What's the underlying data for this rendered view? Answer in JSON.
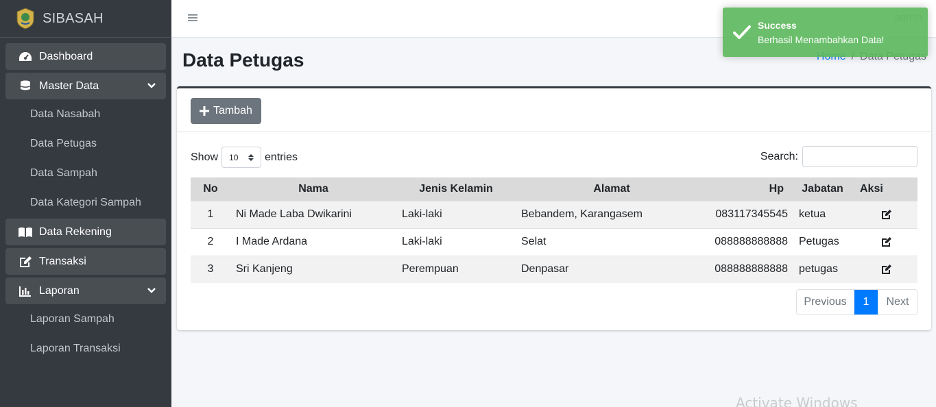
{
  "brand": {
    "name": "SIBASAH"
  },
  "sidebar": {
    "items": [
      {
        "label": "Dashboard",
        "icon": "tachometer-icon"
      },
      {
        "label": "Master Data",
        "icon": "database-icon"
      },
      {
        "label": "Data Rekening",
        "icon": "book-icon"
      },
      {
        "label": "Transaksi",
        "icon": "edit-icon"
      },
      {
        "label": "Laporan",
        "icon": "chart-bar-icon"
      }
    ],
    "master_sub": [
      "Data Nasabah",
      "Data Petugas",
      "Data Sampah",
      "Data Kategori Sampah"
    ],
    "laporan_sub": [
      "Laporan Sampah",
      "Laporan Transaksi"
    ]
  },
  "topbar": {
    "user_label": "admin"
  },
  "page": {
    "title": "Data Petugas"
  },
  "breadcrumb": {
    "home": "Home",
    "separator": "/",
    "current": "Data Petugas"
  },
  "card": {
    "add_button": "Tambah",
    "show_label": "Show",
    "entries_label": "entries",
    "page_length": "10",
    "search_label": "Search:"
  },
  "table": {
    "headers": [
      "No",
      "Nama",
      "Jenis Kelamin",
      "Alamat",
      "Hp",
      "Jabatan",
      "Aksi"
    ],
    "rows": [
      [
        "1",
        "Ni Made Laba Dwikarini",
        "Laki-laki",
        "Bebandem, Karangasem",
        "083117345545",
        "ketua"
      ],
      [
        "2",
        "I Made Ardana",
        "Laki-laki",
        "Selat",
        "088888888888",
        "Petugas"
      ],
      [
        "3",
        "Sri Kanjeng",
        "Perempuan",
        "Denpasar",
        "088888888888",
        "petugas"
      ]
    ]
  },
  "pagination": {
    "previous": "Previous",
    "current": "1",
    "next": "Next"
  },
  "toast": {
    "title": "Success",
    "message": "Berhasil Menambahkan Data!"
  },
  "watermark": {
    "text": "Activate Windows"
  },
  "colors": {
    "sidebar": "#343a40",
    "primary": "#007bff",
    "success": "#5cb85c",
    "secondary": "#6c757d"
  }
}
